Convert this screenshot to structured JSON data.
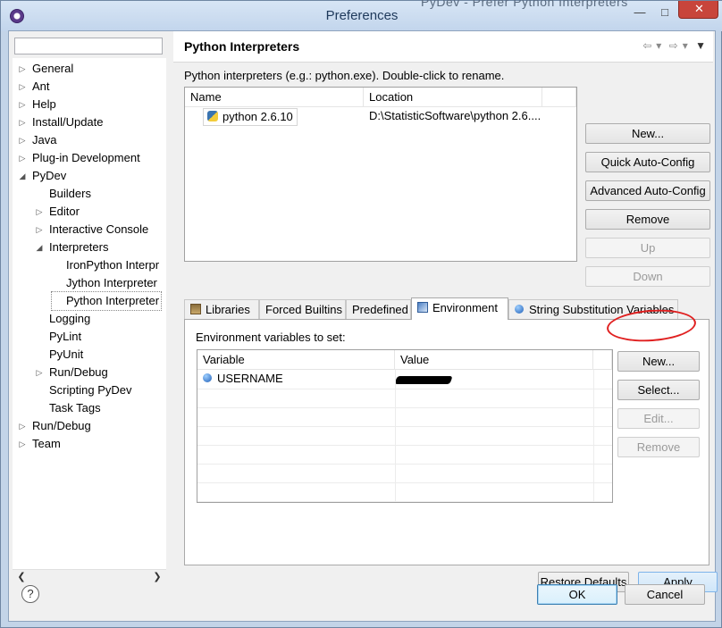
{
  "window": {
    "title": "Preferences",
    "background_text": "PyDev - Prefer Python Interpreters"
  },
  "filter": {
    "placeholder": "",
    "value": ""
  },
  "tree": {
    "items": [
      {
        "label": "General",
        "expanded": false
      },
      {
        "label": "Ant",
        "expanded": false
      },
      {
        "label": "Help",
        "expanded": false
      },
      {
        "label": "Install/Update",
        "expanded": false
      },
      {
        "label": "Java",
        "expanded": false
      },
      {
        "label": "Plug-in Development",
        "expanded": false
      },
      {
        "label": "PyDev",
        "expanded": true
      },
      {
        "label": "Builders"
      },
      {
        "label": "Editor",
        "expanded": false
      },
      {
        "label": "Interactive Console",
        "expanded": false
      },
      {
        "label": "Interpreters",
        "expanded": true
      },
      {
        "label": "IronPython Interpr"
      },
      {
        "label": "Jython Interpreter"
      },
      {
        "label": "Python Interpreter",
        "selected": true
      },
      {
        "label": "Logging"
      },
      {
        "label": "PyLint"
      },
      {
        "label": "PyUnit"
      },
      {
        "label": "Run/Debug",
        "expanded": false
      },
      {
        "label": "Scripting PyDev"
      },
      {
        "label": "Task Tags"
      },
      {
        "label": "Run/Debug",
        "expanded": false
      },
      {
        "label": "Team",
        "expanded": false
      }
    ]
  },
  "page": {
    "title": "Python Interpreters",
    "description": "Python interpreters (e.g.: python.exe).   Double-click to rename.",
    "interpreters_table": {
      "headers": [
        "Name",
        "Location"
      ],
      "rows": [
        {
          "name": "python 2.6.10",
          "location": "D:\\StatisticSoftware\\python 2.6...."
        }
      ]
    },
    "side_buttons": {
      "new": "New...",
      "quick": "Quick Auto-Config",
      "advanced": "Advanced Auto-Config",
      "remove": "Remove",
      "up": "Up",
      "down": "Down"
    },
    "tabs": [
      "Libraries",
      "Forced Builtins",
      "Predefined",
      "Environment",
      "String Substitution Variables"
    ],
    "active_tab": "Environment",
    "env": {
      "label": "Environment variables to set:",
      "headers": [
        "Variable",
        "Value"
      ],
      "rows": [
        {
          "variable": "USERNAME",
          "value": ""
        }
      ],
      "buttons": {
        "new": "New...",
        "select": "Select...",
        "edit": "Edit...",
        "remove": "Remove"
      }
    },
    "restore_defaults": "Restore Defaults",
    "apply": "Apply"
  },
  "footer": {
    "help": "?",
    "ok": "OK",
    "cancel": "Cancel"
  },
  "colors": {
    "titlebar": "#c2d5ec",
    "close": "#c8453b",
    "annotation": "#e02020",
    "default_button": "#3c7fb1"
  }
}
